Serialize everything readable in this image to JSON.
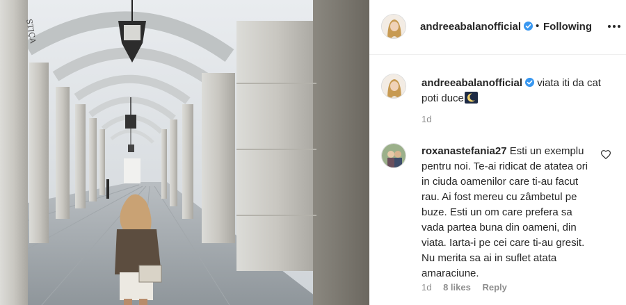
{
  "post": {
    "username": "andreeabalanofficial",
    "follow_status": "Following",
    "separator": "•"
  },
  "caption": {
    "username": "andreeabalanofficial",
    "text": "viata iti da cat poti duce",
    "emoji": "moon-emoji",
    "time": "1d"
  },
  "comment": {
    "username": "roxanastefania27",
    "text": "Esti un exemplu pentru noi. Te-ai ridicat de atatea ori in ciuda oamenilor care ti-au facut rau. Ai fost mereu cu zâmbetul pe buze. Esti un om care prefera sa vada partea buna din oameni, din viata. Iarta-i pe cei care ti-au gresit. Nu merita sa ai in suflet atata amaraciune.",
    "time": "1d",
    "likes": "8 likes",
    "reply_label": "Reply"
  },
  "photo": {
    "sign_text": "STIÇA"
  },
  "colors": {
    "verified": "#3897f0",
    "text": "#262626",
    "muted": "#8e8e8e",
    "border": "#efefef"
  },
  "icons": [
    "verified-badge-icon",
    "more-options-icon",
    "like-heart-icon",
    "moon-emoji"
  ]
}
